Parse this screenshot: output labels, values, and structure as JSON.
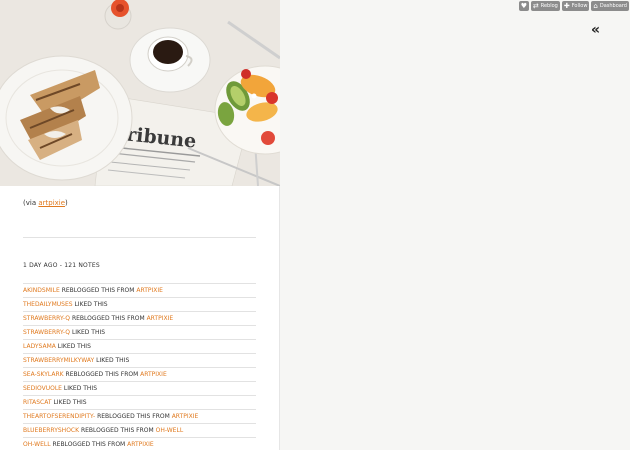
{
  "controls": {
    "like_icon": "heart-icon",
    "reblog_icon": "reblog-icon",
    "reblog_label": "Reblog",
    "follow_icon": "plus-icon",
    "follow_label": "Follow",
    "dashboard_icon": "home-icon",
    "dashboard_label": "Dashboard"
  },
  "nav": {
    "back_glyph": "«"
  },
  "post": {
    "newspaper_text": "Tribune",
    "via_prefix": "(via ",
    "via_user": "artpixie",
    "via_suffix": ")",
    "meta": "1 DAY AGO - 121 NOTES",
    "notes": [
      {
        "user": "AKINDSMILE",
        "action": " REBLOGGED THIS FROM ",
        "source": "ARTPIXIE"
      },
      {
        "user": "THEDAILYMUSES",
        "action": " LIKED THIS",
        "source": ""
      },
      {
        "user": "STRAWBERRY-Q",
        "action": " REBLOGGED THIS FROM ",
        "source": "ARTPIXIE"
      },
      {
        "user": "STRAWBERRY-Q",
        "action": " LIKED THIS",
        "source": ""
      },
      {
        "user": "LADYSAMA",
        "action": " LIKED THIS",
        "source": ""
      },
      {
        "user": "STRAWBERRYMILKYWAY",
        "action": " LIKED THIS",
        "source": ""
      },
      {
        "user": "SEA-SKYLARK",
        "action": " REBLOGGED THIS FROM ",
        "source": "ARTPIXIE"
      },
      {
        "user": "SEDIOVUOLE",
        "action": " LIKED THIS",
        "source": ""
      },
      {
        "user": "RITASCAT",
        "action": " LIKED THIS",
        "source": ""
      },
      {
        "user": "THEARTOFSERENDIPITY-",
        "action": " REBLOGGED THIS FROM ",
        "source": "ARTPIXIE"
      },
      {
        "user": "BLUEBERRYSHOCK",
        "action": " REBLOGGED THIS FROM ",
        "source": "OH-WELL"
      },
      {
        "user": "OH-WELL",
        "action": " REBLOGGED THIS FROM ",
        "source": "ARTPIXIE"
      }
    ]
  },
  "colors": {
    "accent": "#e07a1f",
    "control_bg": "#8c8c8c",
    "page_bg": "#f6f6f4"
  }
}
